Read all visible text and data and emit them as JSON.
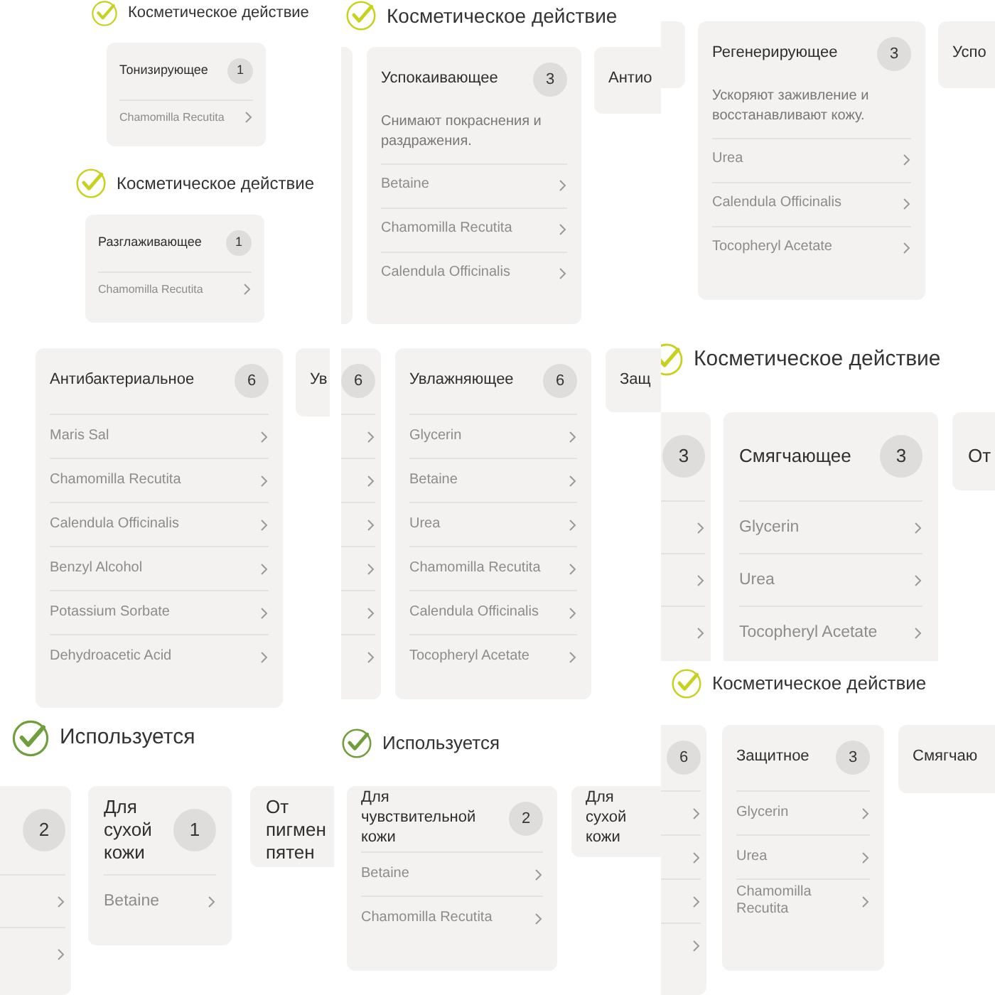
{
  "shots": [
    {
      "heading": {
        "text": "Косметическое действие",
        "color": "#c8d21e"
      },
      "cards": [
        {
          "kind": "card",
          "title": "Тонизирующее",
          "count": "1",
          "items": [
            {
              "kind": "ingredient",
              "name": "Chamomilla Recutita"
            }
          ]
        }
      ]
    },
    {
      "heading": {
        "text": "Косметическое действие",
        "color": "#c8d21e"
      },
      "cards": [
        {
          "kind": "card",
          "title": "Разглаживающее",
          "count": "1",
          "items": [
            {
              "kind": "ingredient",
              "name": "Chamomilla Recutita"
            }
          ]
        }
      ]
    },
    {
      "heading": {
        "text": "Косметическое действие",
        "color": "#c8d21e"
      },
      "cards": [
        {
          "kind": "edge"
        },
        {
          "kind": "card",
          "title": "Успокаивающее",
          "count": "3",
          "description": "Снимают покраснения и раздражения.",
          "items": [
            {
              "kind": "ingredient",
              "name": "Betaine"
            },
            {
              "kind": "ingredient",
              "name": "Chamomilla Recutita"
            },
            {
              "kind": "ingredient",
              "name": "Calendula Officinalis"
            }
          ]
        },
        {
          "kind": "card",
          "title": "Антио"
        }
      ]
    },
    {
      "cards": [
        {
          "kind": "edge"
        },
        {
          "kind": "card",
          "title": "Регенерирующее",
          "count": "3",
          "description": "Ускоряют заживление и восстанавливают кожу.",
          "items": [
            {
              "kind": "ingredient",
              "name": "Urea"
            },
            {
              "kind": "ingredient",
              "name": "Calendula Officinalis"
            },
            {
              "kind": "ingredient",
              "name": "Tocopheryl Acetate"
            }
          ]
        },
        {
          "kind": "card",
          "title": "Успо"
        }
      ]
    },
    {
      "cards": [
        {
          "kind": "card",
          "title": "Антибактериальное",
          "count": "6",
          "items": [
            {
              "kind": "ingredient",
              "name": "Maris Sal"
            },
            {
              "kind": "ingredient",
              "name": "Chamomilla Recutita"
            },
            {
              "kind": "ingredient",
              "name": "Calendula Officinalis"
            },
            {
              "kind": "ingredient",
              "name": "Benzyl Alcohol"
            },
            {
              "kind": "ingredient",
              "name": "Potassium Sorbate"
            },
            {
              "kind": "ingredient",
              "name": "Dehydroacetic Acid"
            }
          ]
        },
        {
          "kind": "card",
          "title": "Ув"
        }
      ]
    },
    {
      "cards": [
        {
          "kind": "card",
          "count": "6",
          "items": [
            {
              "kind": "hidden"
            },
            {
              "kind": "hidden"
            },
            {
              "kind": "hidden"
            },
            {
              "kind": "hidden"
            },
            {
              "kind": "hidden"
            },
            {
              "kind": "hidden"
            }
          ]
        },
        {
          "kind": "card",
          "title": "Увлажняющее",
          "count": "6",
          "items": [
            {
              "kind": "ingredient",
              "name": "Glycerin"
            },
            {
              "kind": "ingredient",
              "name": "Betaine"
            },
            {
              "kind": "ingredient",
              "name": "Urea"
            },
            {
              "kind": "ingredient",
              "name": "Chamomilla Recutita"
            },
            {
              "kind": "ingredient",
              "name": "Calendula Officinalis"
            },
            {
              "kind": "ingredient",
              "name": "Tocopheryl Acetate"
            }
          ]
        },
        {
          "kind": "card",
          "title": "Защ"
        }
      ]
    },
    {
      "heading": {
        "text": "Косметическое действие",
        "color": "#c8d21e"
      },
      "cards": [
        {
          "kind": "card",
          "count": "3",
          "items": [
            {
              "kind": "hidden"
            },
            {
              "kind": "hidden"
            },
            {
              "kind": "hidden"
            }
          ]
        },
        {
          "kind": "card",
          "title": "Смягчающее",
          "count": "3",
          "items": [
            {
              "kind": "ingredient",
              "name": "Glycerin"
            },
            {
              "kind": "ingredient",
              "name": "Urea"
            },
            {
              "kind": "ingredient",
              "name": "Tocopheryl Acetate"
            }
          ]
        },
        {
          "kind": "card",
          "title": "От"
        }
      ]
    },
    {
      "heading": {
        "text": "Косметическое действие",
        "color": "#c8d21e"
      },
      "cards": [
        {
          "kind": "card",
          "count": "6",
          "items": [
            {
              "kind": "hidden"
            },
            {
              "kind": "hidden"
            },
            {
              "kind": "hidden"
            },
            {
              "kind": "hidden"
            }
          ]
        },
        {
          "kind": "card",
          "title": "Защитное",
          "count": "3",
          "items": [
            {
              "kind": "ingredient",
              "name": "Glycerin"
            },
            {
              "kind": "ingredient",
              "name": "Urea"
            },
            {
              "kind": "ingredient",
              "name": "Chamomilla Recutita"
            }
          ]
        },
        {
          "kind": "card",
          "title": "Смягчаю"
        }
      ]
    },
    {
      "heading": {
        "text": "Используется",
        "color": "#6f9e3c"
      },
      "cards": [
        {
          "kind": "card",
          "count": "2",
          "items": [
            {
              "kind": "hidden"
            },
            {
              "kind": "hidden"
            }
          ]
        },
        {
          "kind": "card",
          "title": "Для сухой кожи",
          "count": "1",
          "items": [
            {
              "kind": "ingredient",
              "name": "Betaine"
            }
          ]
        },
        {
          "kind": "card",
          "title": "От пигмен пятен"
        }
      ]
    },
    {
      "heading": {
        "text": "Используется",
        "color": "#6f9e3c"
      },
      "cards": [
        {
          "kind": "card",
          "title": "Для чувствительной кожи",
          "count": "2",
          "items": [
            {
              "kind": "ingredient",
              "name": "Betaine"
            },
            {
              "kind": "ingredient",
              "name": "Chamomilla Recutita"
            }
          ]
        },
        {
          "kind": "card",
          "title": "Для сухой кожи"
        }
      ]
    }
  ]
}
